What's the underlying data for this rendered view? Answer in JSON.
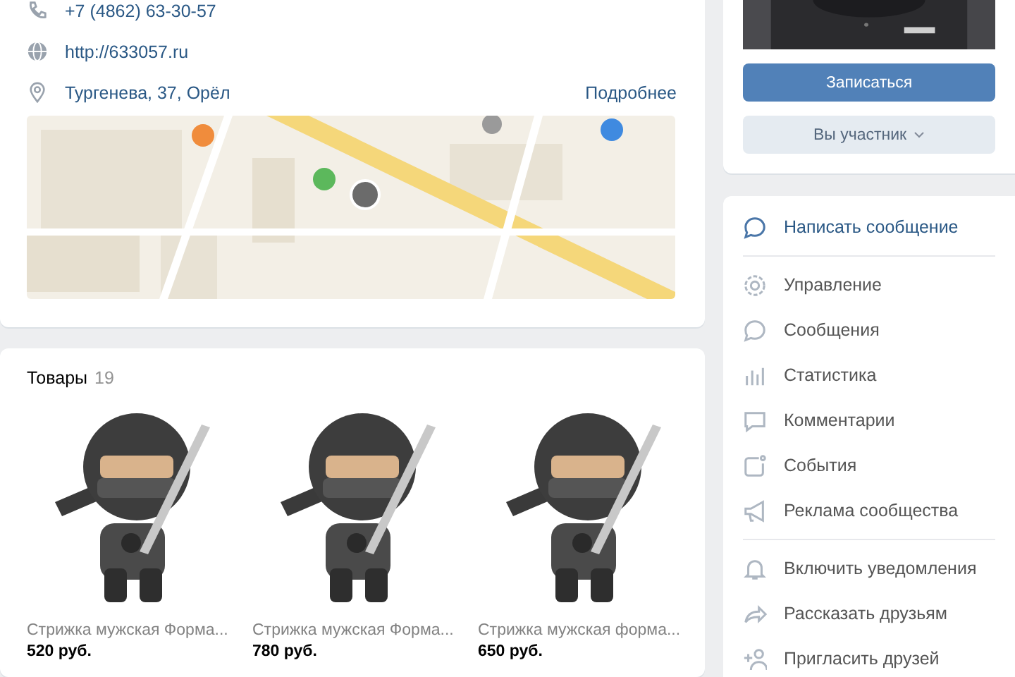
{
  "contacts": [
    {
      "kind": "phone",
      "text": "+7 (4862) 63-30-57"
    },
    {
      "kind": "site",
      "text": "http://633057.ru"
    },
    {
      "kind": "address",
      "text": "Тургенева, 37, Орёл",
      "link": "Подробнее"
    }
  ],
  "products": {
    "title": "Товары",
    "count": "19",
    "items": [
      {
        "name": "Стрижка мужская Форма...",
        "price": "520 руб."
      },
      {
        "name": "Стрижка мужская Форма...",
        "price": "780 руб."
      },
      {
        "name": "Стрижка мужская форма...",
        "price": "650 руб."
      }
    ]
  },
  "buttons": [
    {
      "label": "Записаться",
      "kind": "primary"
    },
    {
      "label": "Вы участник",
      "kind": "secondary",
      "dropdown": true
    }
  ],
  "menu_sections": [
    {
      "items": [
        {
          "label": "Написать сообщение",
          "kind": "primary"
        }
      ]
    },
    {
      "items": [
        {
          "label": "Управление",
          "kind": "plain"
        },
        {
          "label": "Сообщения",
          "kind": "plain"
        },
        {
          "label": "Статистика",
          "kind": "plain"
        },
        {
          "label": "Комментарии",
          "kind": "plain"
        },
        {
          "label": "События",
          "kind": "plain"
        },
        {
          "label": "Реклама сообщества",
          "kind": "plain"
        }
      ]
    },
    {
      "items": [
        {
          "label": "Включить уведомления",
          "kind": "plain"
        },
        {
          "label": "Рассказать друзьям",
          "kind": "plain"
        },
        {
          "label": "Пригласить друзей",
          "kind": "plain"
        }
      ]
    }
  ]
}
